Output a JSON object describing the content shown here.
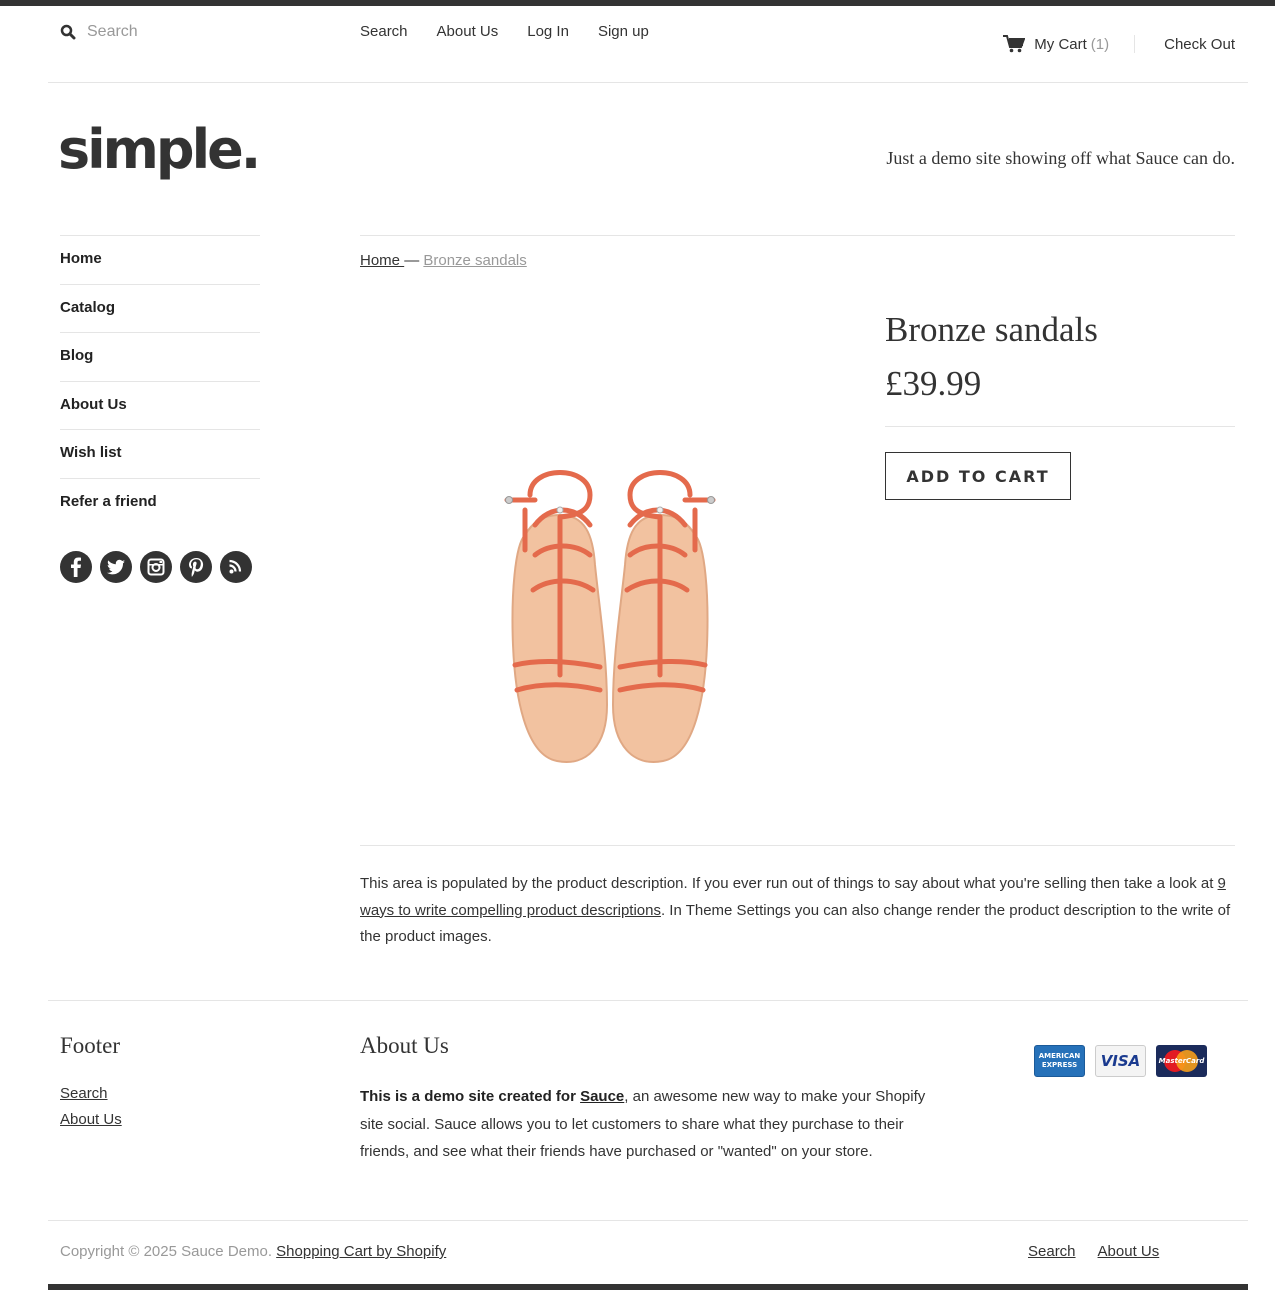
{
  "header": {
    "search_placeholder": "Search",
    "nav": [
      "Search",
      "About Us",
      "Log In",
      "Sign up"
    ],
    "cart_label": "My Cart",
    "cart_count": "(1)",
    "checkout_label": "Check Out"
  },
  "brand": {
    "logo_text": "simple.",
    "tagline": "Just a demo site showing off what Sauce can do."
  },
  "sidebar": {
    "items": [
      "Home",
      "Catalog",
      "Blog",
      "About Us",
      "Wish list",
      "Refer a friend"
    ],
    "social": [
      "facebook-icon",
      "twitter-icon",
      "instagram-icon",
      "pinterest-icon",
      "rss-icon"
    ]
  },
  "breadcrumb": {
    "home": "Home ",
    "separator": " — ",
    "current": "Bronze sandals"
  },
  "product": {
    "title": "Bronze sandals",
    "price": "£39.99",
    "add_to_cart": "ADD TO CART",
    "description_part1": "This area is populated by the product description. If you ever run out of things to say about what you're selling then take a look at ",
    "description_link": "9 ways to write compelling product descriptions",
    "description_part2": ". In Theme Settings you can also change render the product description to the write of the product images."
  },
  "footer": {
    "col1_heading": "Footer",
    "col1_links": [
      "Search",
      "About Us"
    ],
    "col2_heading": "About Us",
    "about_bold": "This is a demo site created for ",
    "about_link": "Sauce",
    "about_rest": ", an awesome new way to make your Shopify site social. Sauce allows you to let customers to share what they purchase to their friends, and see what their friends have purchased or \"wanted\" on your store.",
    "cards": [
      "AMERICAN EXPRESS",
      "VISA",
      "MasterCard"
    ]
  },
  "bottom": {
    "copyright": "Copyright © 2025 Sauce Demo. ",
    "shopify_link": "Shopping Cart by Shopify",
    "links": [
      "Search",
      "About Us"
    ]
  },
  "colors": {
    "text": "#333333",
    "muted": "#999999",
    "rule": "#e5e5e5",
    "bar": "#333333"
  }
}
